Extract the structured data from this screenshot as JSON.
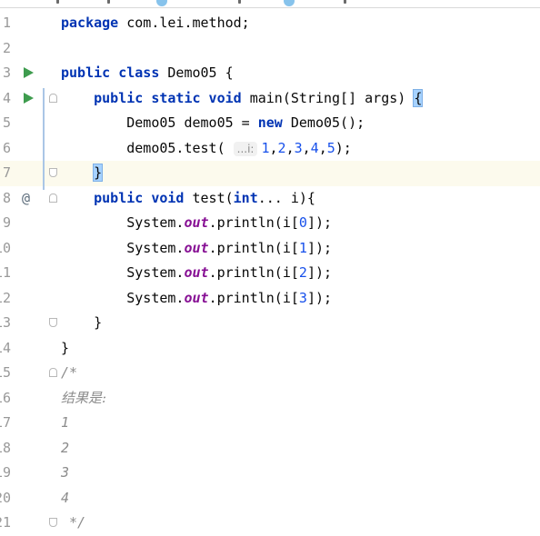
{
  "editor": {
    "inlay_hint": "...i:",
    "lines": [
      {
        "num": "1",
        "code": "package com.lei.method;"
      },
      {
        "num": "2",
        "code": ""
      },
      {
        "num": "3",
        "code": "public class Demo05 {"
      },
      {
        "num": "4",
        "code": "    public static void main(String[] args) {"
      },
      {
        "num": "5",
        "code": "        Demo05 demo05 = new Demo05();"
      },
      {
        "num": "6",
        "code": "        demo05.test( ...i: 1,2,3,4,5);"
      },
      {
        "num": "7",
        "code": "    }"
      },
      {
        "num": "8",
        "code": "    public void test(int... i){"
      },
      {
        "num": "9",
        "code": "        System.out.println(i[0]);"
      },
      {
        "num": "10",
        "code": "        System.out.println(i[1]);"
      },
      {
        "num": "11",
        "code": "        System.out.println(i[2]);"
      },
      {
        "num": "12",
        "code": "        System.out.println(i[3]);"
      },
      {
        "num": "13",
        "code": "    }"
      },
      {
        "num": "14",
        "code": "}"
      },
      {
        "num": "15",
        "code": "/*"
      },
      {
        "num": "16",
        "code": "结果是:"
      },
      {
        "num": "17",
        "code": "1"
      },
      {
        "num": "18",
        "code": "2"
      },
      {
        "num": "19",
        "code": "3"
      },
      {
        "num": "20",
        "code": "4"
      },
      {
        "num": "21",
        "code": " */"
      }
    ],
    "current_line": 7
  },
  "gutter_icons": {
    "run": "run-arrow-icon",
    "override": "implements-override-icon",
    "fold": "fold-marker-icon"
  },
  "colors": {
    "keyword": "#0033b3",
    "number": "#1750eb",
    "static_field": "#871094",
    "comment": "#8c8c8c",
    "current_line_bg": "#fcfaed",
    "run_icon": "#3e9c4e"
  }
}
